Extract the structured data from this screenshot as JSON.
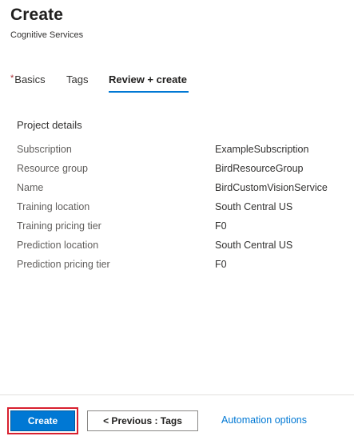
{
  "header": {
    "title": "Create",
    "subtitle": "Cognitive Services"
  },
  "tabs": [
    {
      "label": "Basics",
      "required_marker": "*",
      "active": false
    },
    {
      "label": "Tags",
      "active": false
    },
    {
      "label": "Review + create",
      "active": true
    }
  ],
  "project_details": {
    "title": "Project details",
    "rows": [
      {
        "label": "Subscription",
        "value": "ExampleSubscription"
      },
      {
        "label": "Resource group",
        "value": "BirdResourceGroup"
      },
      {
        "label": "Name",
        "value": "BirdCustomVisionService"
      },
      {
        "label": "Training location",
        "value": "South Central US"
      },
      {
        "label": "Training pricing tier",
        "value": "F0"
      },
      {
        "label": "Prediction location",
        "value": "South Central US"
      },
      {
        "label": "Prediction pricing tier",
        "value": "F0"
      }
    ]
  },
  "footer": {
    "create_label": "Create",
    "previous_label": "< Previous : Tags",
    "automation_label": "Automation options"
  },
  "colors": {
    "accent": "#0078d4",
    "highlight": "#d8202f",
    "required": "#a4262c"
  }
}
